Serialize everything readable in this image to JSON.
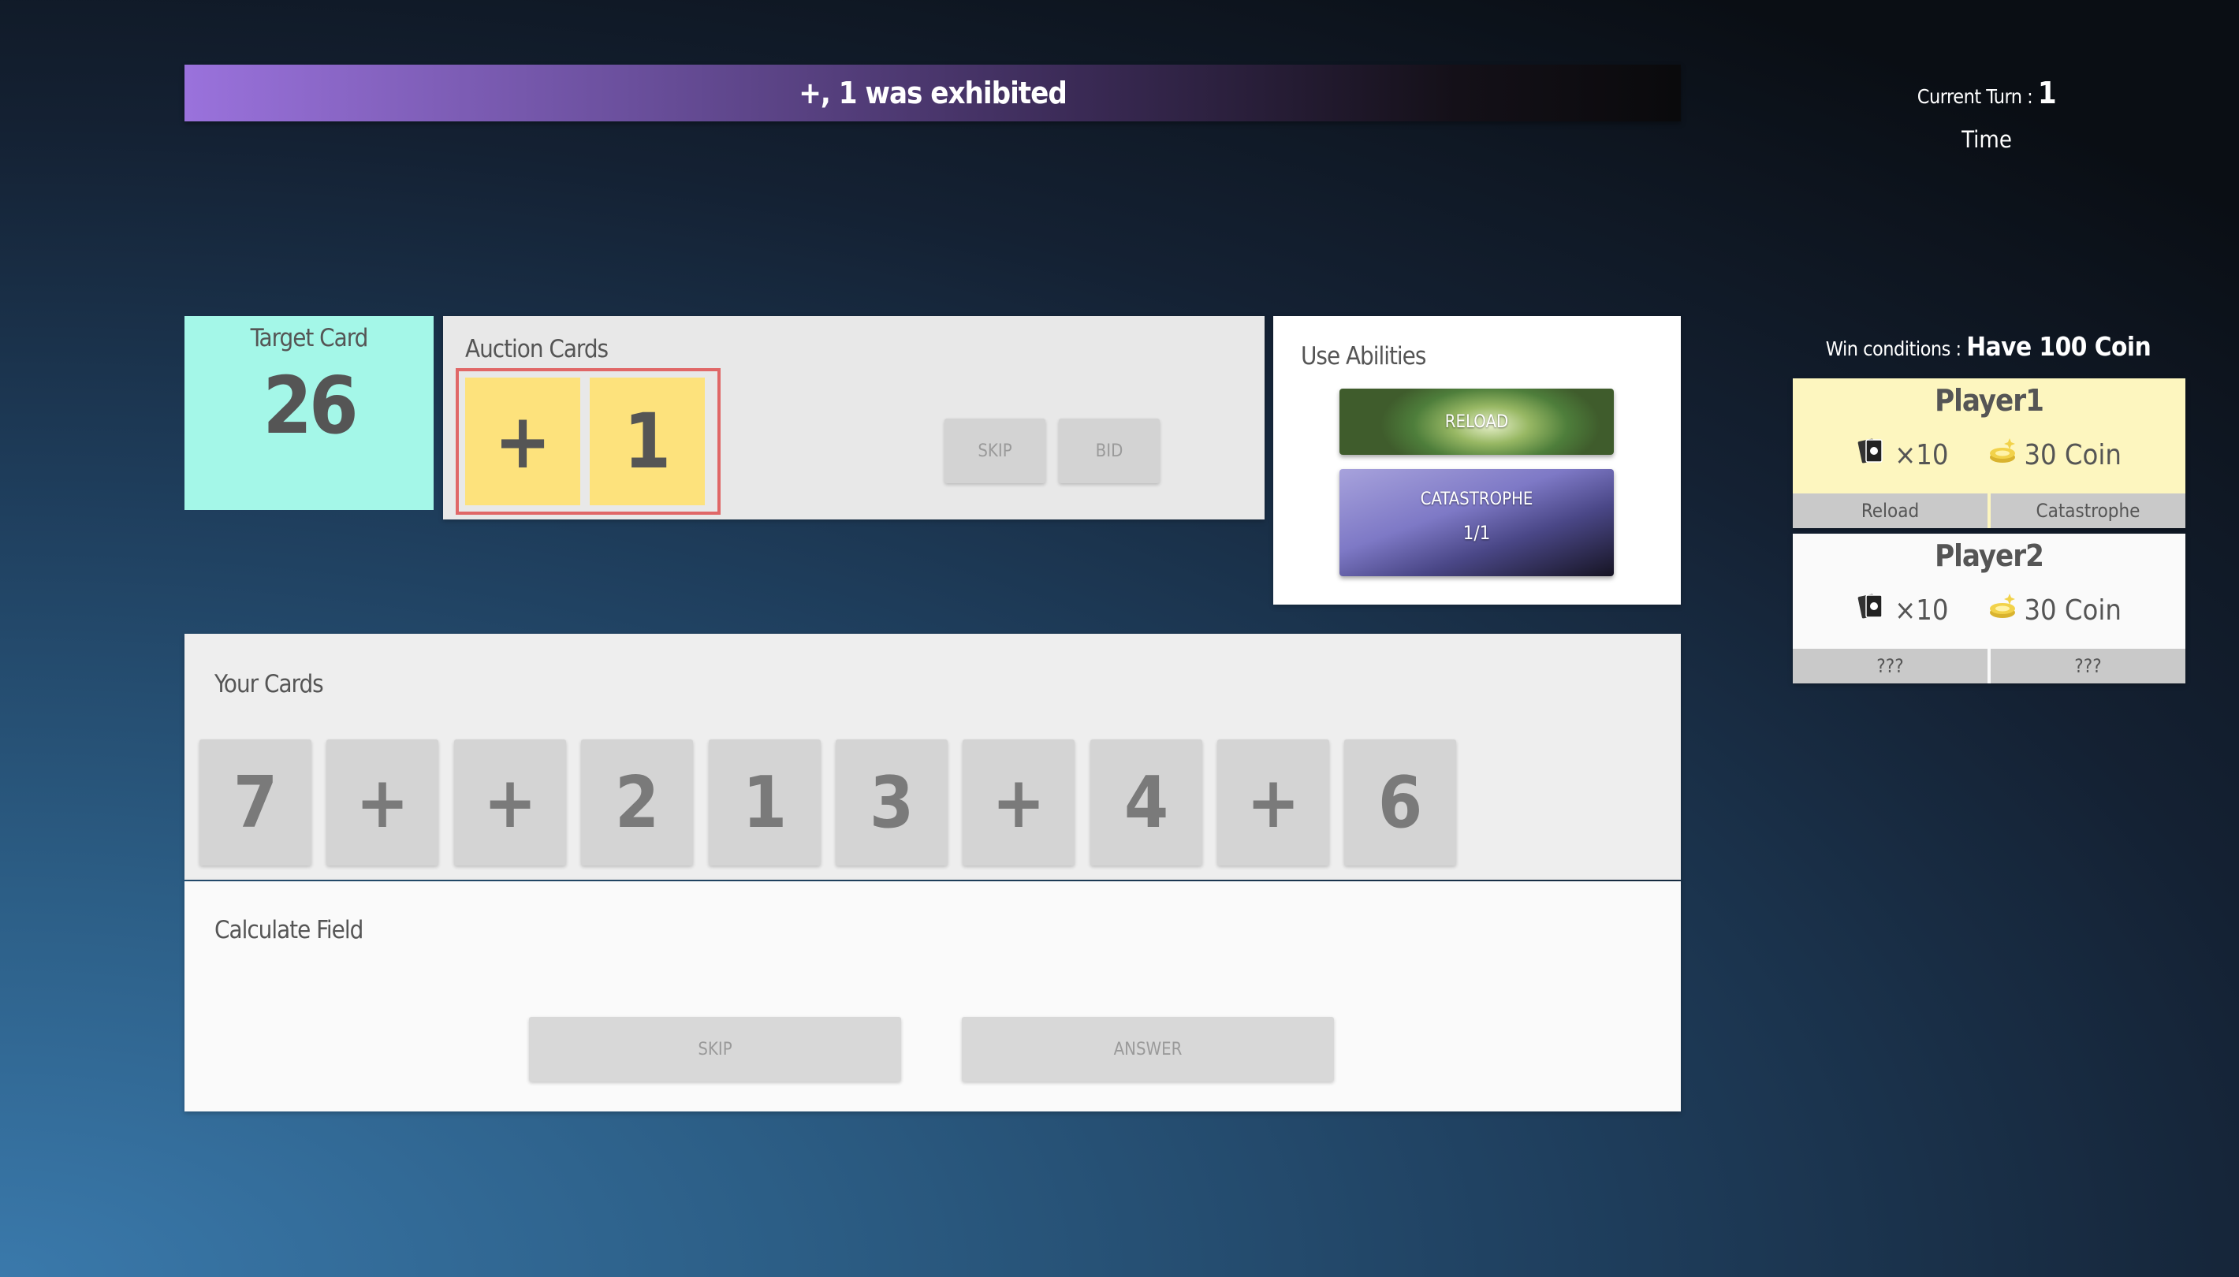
{
  "banner": {
    "text": "+, 1 was exhibited"
  },
  "turn": {
    "label": "Current Turn :",
    "value": "1"
  },
  "time": {
    "label": "Time"
  },
  "target": {
    "title": "Target Card",
    "value": "26"
  },
  "auction": {
    "title": "Auction Cards",
    "cards": [
      "+",
      "1"
    ],
    "skip_label": "SKIP",
    "bid_label": "BID"
  },
  "abilities": {
    "title": "Use Abilities",
    "reload_label": "RELOAD",
    "catastrophe_label": "CATASTROPHE",
    "catastrophe_count": "1/1"
  },
  "your_cards": {
    "title": "Your Cards",
    "cards": [
      "7",
      "+",
      "+",
      "2",
      "1",
      "3",
      "+",
      "4",
      "+",
      "6"
    ]
  },
  "calc": {
    "title": "Calculate Field",
    "skip_label": "SKIP",
    "answer_label": "ANSWER"
  },
  "win": {
    "label": "Win conditions :",
    "value": "Have 100 Coin"
  },
  "players": [
    {
      "name": "Player1",
      "cards": "×10",
      "coins": "30 Coin",
      "ability1": "Reload",
      "ability2": "Catastrophe"
    },
    {
      "name": "Player2",
      "cards": "×10",
      "coins": "30 Coin",
      "ability1": "???",
      "ability2": "???"
    }
  ],
  "colors": {
    "target_bg": "#a4f7e8",
    "auction_card_bg": "#fde27c",
    "auction_highlight": "#e06767",
    "active_player_bg": "#fdf6bf",
    "coin": "#f2d24a"
  }
}
